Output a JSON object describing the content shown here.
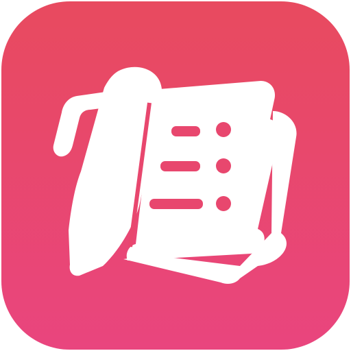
{
  "app_icon": {
    "icon": "notes-list-with-pen-icon",
    "colors": {
      "gradient_top": "#E84A5F",
      "gradient_bottom": "#E9457E",
      "glyph": "#FFFFFF"
    }
  }
}
